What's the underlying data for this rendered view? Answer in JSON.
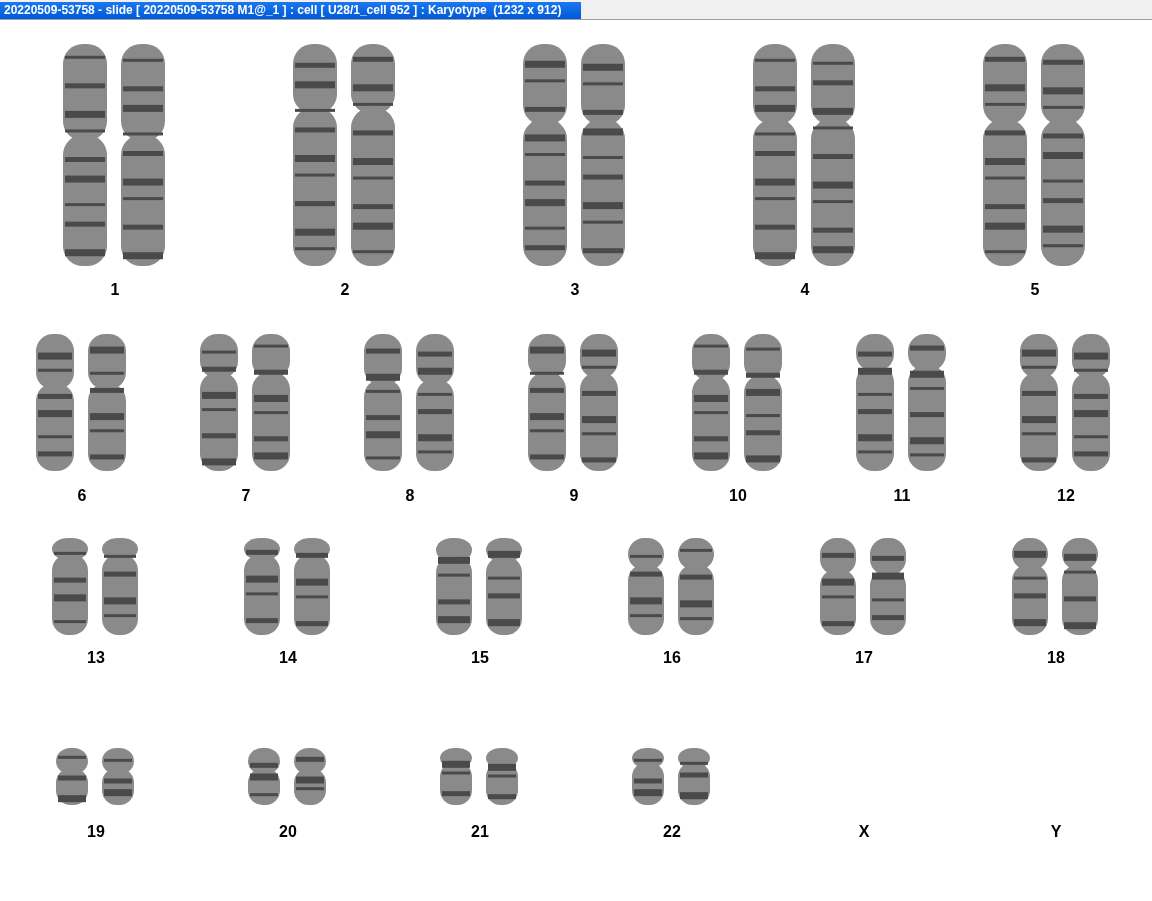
{
  "window": {
    "title": "20220509-53758 - slide [ 20220509-53758 M1@_1 ] : cell [ U28/1_cell 952 ] : Karyotype  (1232 x 912)"
  },
  "karyotype": {
    "rows": [
      {
        "items": [
          {
            "label": "1",
            "kind": "pair"
          },
          {
            "label": "2",
            "kind": "pair"
          },
          {
            "label": "3",
            "kind": "pair"
          },
          {
            "label": "4",
            "kind": "pair"
          },
          {
            "label": "5",
            "kind": "pair"
          }
        ]
      },
      {
        "items": [
          {
            "label": "6",
            "kind": "pair"
          },
          {
            "label": "7",
            "kind": "pair"
          },
          {
            "label": "8",
            "kind": "pair"
          },
          {
            "label": "9",
            "kind": "pair"
          },
          {
            "label": "10",
            "kind": "pair"
          },
          {
            "label": "11",
            "kind": "pair"
          },
          {
            "label": "12",
            "kind": "pair"
          }
        ]
      },
      {
        "items": [
          {
            "label": "13",
            "kind": "pair"
          },
          {
            "label": "14",
            "kind": "pair"
          },
          {
            "label": "15",
            "kind": "pair"
          },
          {
            "label": "16",
            "kind": "pair"
          },
          {
            "label": "17",
            "kind": "pair"
          },
          {
            "label": "18",
            "kind": "pair"
          }
        ]
      },
      {
        "items": [
          {
            "label": "19",
            "kind": "pair"
          },
          {
            "label": "20",
            "kind": "pair"
          },
          {
            "label": "21",
            "kind": "pair"
          },
          {
            "label": "22",
            "kind": "pair"
          },
          {
            "label": "X",
            "kind": "empty"
          },
          {
            "label": "Y",
            "kind": "empty"
          }
        ]
      }
    ]
  }
}
